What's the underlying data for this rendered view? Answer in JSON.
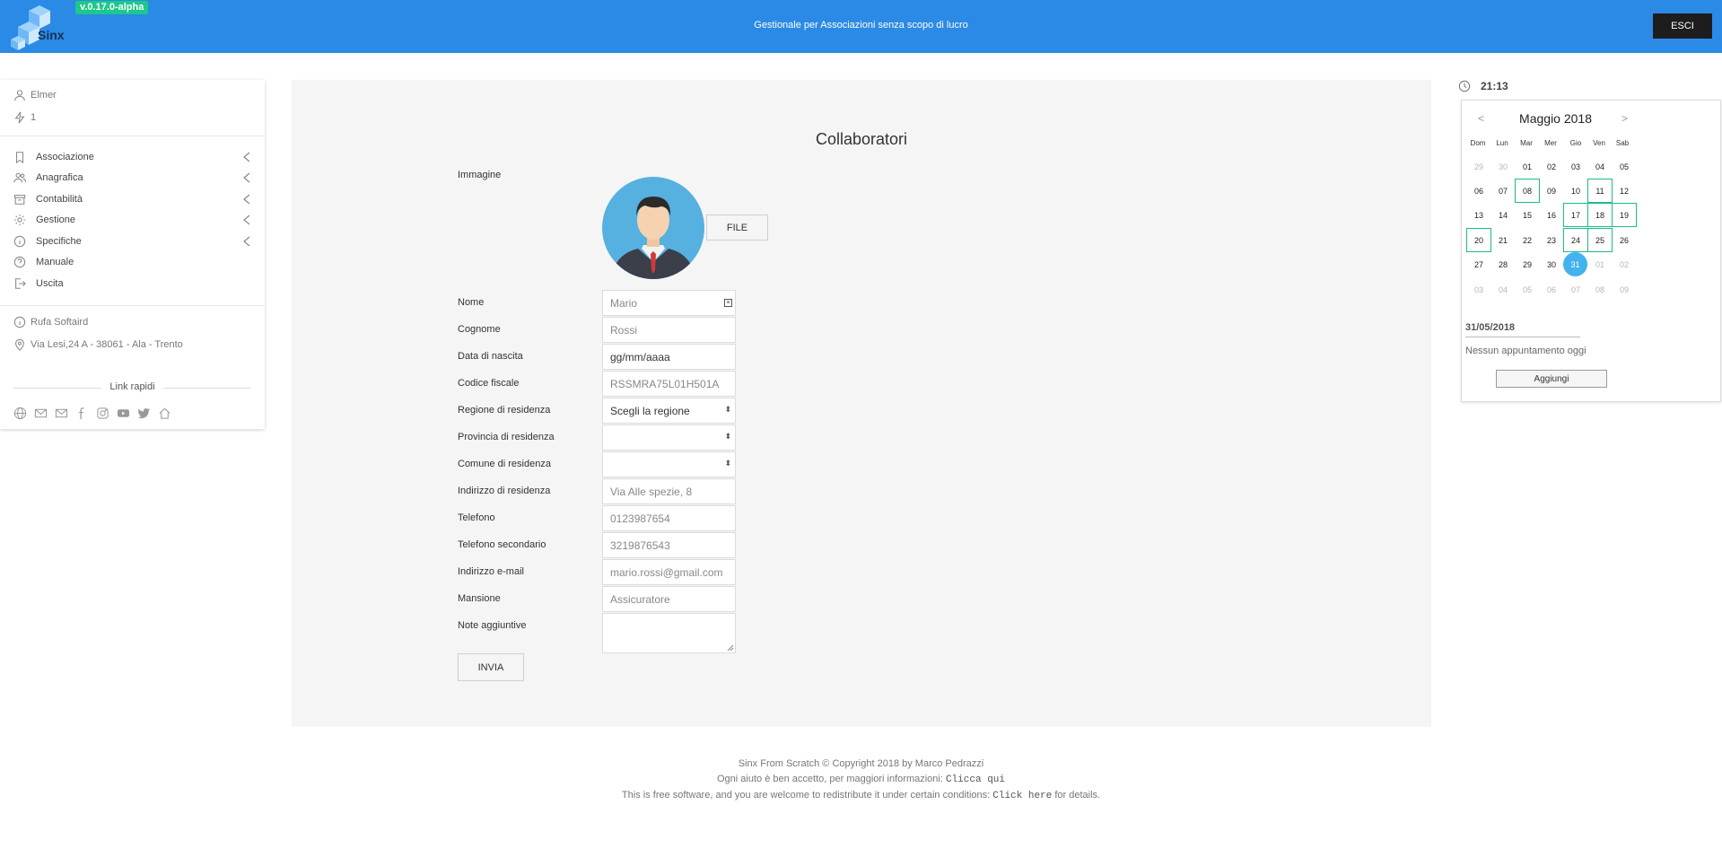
{
  "header": {
    "app_name": "Sinx",
    "version": "v.0.17.0-alpha",
    "tagline": "Gestionale per Associazioni senza scopo di lucro",
    "logout_label": "ESCI"
  },
  "sidebar": {
    "user_name": "Elmer",
    "user_level": "1",
    "nav": [
      {
        "label": "Associazione",
        "icon": "bookmark-icon",
        "has_submenu": true
      },
      {
        "label": "Anagrafica",
        "icon": "users-icon",
        "has_submenu": true
      },
      {
        "label": "Contabilità",
        "icon": "archive-icon",
        "has_submenu": true
      },
      {
        "label": "Gestione",
        "icon": "gear-icon",
        "has_submenu": true
      },
      {
        "label": "Specifiche",
        "icon": "info-icon",
        "has_submenu": true
      },
      {
        "label": "Manuale",
        "icon": "help-icon",
        "has_submenu": false
      },
      {
        "label": "Uscita",
        "icon": "exit-icon",
        "has_submenu": false
      }
    ],
    "org_name": "Rufa Softaird",
    "org_address": "Via Lesi,24 A - 38061 - Ala - Trento",
    "quick_links_label": "Link rapidi",
    "social_icons": [
      "globe-icon",
      "mail-icon",
      "mail-icon",
      "facebook-icon",
      "instagram-icon",
      "youtube-icon",
      "twitter-icon",
      "home-icon"
    ]
  },
  "form": {
    "title": "Collaboratori",
    "image_label": "Immagine",
    "file_label": "FILE",
    "fields": [
      {
        "label": "Nome",
        "placeholder": "Mario",
        "kind": "text"
      },
      {
        "label": "Cognome",
        "placeholder": "Rossi",
        "kind": "text"
      },
      {
        "label": "Data di nascita",
        "placeholder": "gg/mm/aaaa",
        "kind": "date"
      },
      {
        "label": "Codice fiscale",
        "placeholder": "RSSMRA75L01H501A",
        "kind": "text"
      },
      {
        "label": "Regione di residenza",
        "placeholder": "Scegli la regione",
        "kind": "select"
      },
      {
        "label": "Provincia di residenza",
        "placeholder": "",
        "kind": "select"
      },
      {
        "label": "Comune di residenza",
        "placeholder": "",
        "kind": "select"
      },
      {
        "label": "Indirizzo di residenza",
        "placeholder": "Via Alle spezie, 8",
        "kind": "text"
      },
      {
        "label": "Telefono",
        "placeholder": "0123987654",
        "kind": "text"
      },
      {
        "label": "Telefono secondario",
        "placeholder": "3219876543",
        "kind": "text"
      },
      {
        "label": "Indirizzo e-mail",
        "placeholder": "mario.rossi@gmail.com",
        "kind": "text"
      },
      {
        "label": "Mansione",
        "placeholder": "Assicuratore",
        "kind": "text"
      }
    ],
    "notes_label": "Note aggiuntive",
    "submit_label": "INVIA"
  },
  "clock": {
    "time": "21:13"
  },
  "calendar": {
    "month_title": "Maggio 2018",
    "prev": "<",
    "next": ">",
    "weekdays": [
      "Dom",
      "Lun",
      "Mar",
      "Mer",
      "Gio",
      "Ven",
      "Sab"
    ],
    "weeks": [
      [
        "29",
        "30",
        "01",
        "02",
        "03",
        "04",
        "05"
      ],
      [
        "06",
        "07",
        "08",
        "09",
        "10",
        "11",
        "12"
      ],
      [
        "13",
        "14",
        "15",
        "16",
        "17",
        "18",
        "19"
      ],
      [
        "20",
        "21",
        "22",
        "23",
        "24",
        "25",
        "26"
      ],
      [
        "27",
        "28",
        "29",
        "30",
        "31",
        "01",
        "02"
      ],
      [
        "03",
        "04",
        "05",
        "06",
        "07",
        "08",
        "09"
      ]
    ],
    "muted_cells": [
      "0-0",
      "0-1",
      "4-5",
      "4-6",
      "5-0",
      "5-1",
      "5-2",
      "5-3",
      "5-4",
      "5-5",
      "5-6"
    ],
    "event_cells": [
      "1-2",
      "1-5",
      "2-4",
      "2-5",
      "2-6",
      "3-0",
      "3-4",
      "3-5"
    ],
    "today_cell": "4-4",
    "selected_date": "31/05/2018",
    "no_events_text": "Nessun appuntamento oggi",
    "add_label": "Aggiungi",
    "colors": {
      "event_border": "#1cbb8f",
      "today": "#42b3ef"
    }
  },
  "footer": {
    "line1": "Sinx From Scratch © Copyright 2018 by Marco Pedrazzi",
    "line2_text": "Ogni aiuto è ben accetto, per maggiori informazioni:",
    "line2_link": "Clicca qui",
    "line3_text": "This is free software, and you are welcome to redistribute it under certain conditions:",
    "line3_link": "Click here",
    "line3_tail": "for details."
  },
  "colors": {
    "header_bg": "#2b8ae6",
    "version_badge": "#1cc88a",
    "logout_bg": "#1d1d1d",
    "panel_bg": "#f5f5f5"
  }
}
